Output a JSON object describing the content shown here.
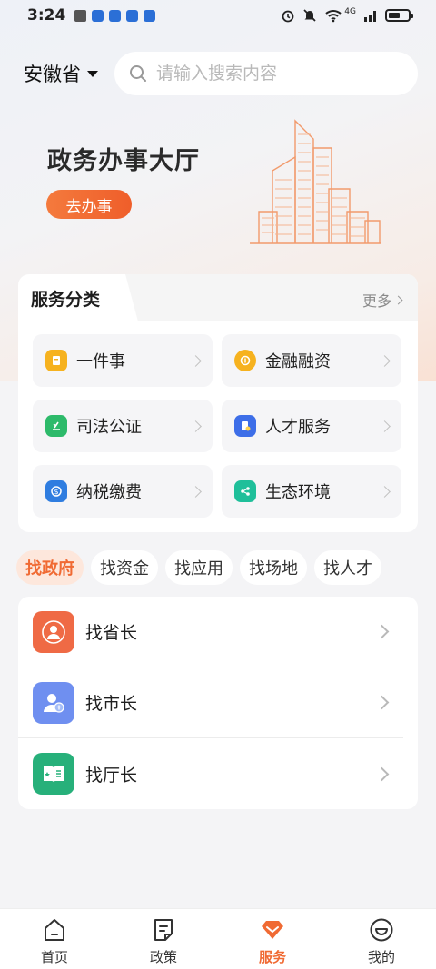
{
  "status_bar": {
    "time": "3:24",
    "network": "4G"
  },
  "header": {
    "province": "安徽省",
    "search_placeholder": "请输入搜索内容"
  },
  "hero": {
    "title": "政务办事大厅",
    "button": "去办事"
  },
  "service_category": {
    "title": "服务分类",
    "more": "更多",
    "items": [
      {
        "label": "一件事",
        "icon": "document-icon",
        "color": "#f6b21f"
      },
      {
        "label": "金融融资",
        "icon": "finance-icon",
        "color": "#f6b21f"
      },
      {
        "label": "司法公证",
        "icon": "justice-icon",
        "color": "#2dba6a"
      },
      {
        "label": "人才服务",
        "icon": "talent-icon",
        "color": "#3d6ee8"
      },
      {
        "label": "纳税缴费",
        "icon": "tax-icon",
        "color": "#2f7de0"
      },
      {
        "label": "生态环境",
        "icon": "ecology-icon",
        "color": "#1fbf9a"
      }
    ]
  },
  "filter_tabs": [
    {
      "label": "找政府",
      "active": true
    },
    {
      "label": "找资金",
      "active": false
    },
    {
      "label": "找应用",
      "active": false
    },
    {
      "label": "找场地",
      "active": false
    },
    {
      "label": "找人才",
      "active": false
    }
  ],
  "list": [
    {
      "label": "找省长",
      "icon": "governor-icon",
      "color": "#ef6a45"
    },
    {
      "label": "找市长",
      "icon": "mayor-icon",
      "color": "#6f8ff0"
    },
    {
      "label": "找厅长",
      "icon": "director-icon",
      "color": "#27b07a"
    }
  ],
  "bottom_nav": [
    {
      "label": "首页",
      "icon": "home-icon",
      "active": false
    },
    {
      "label": "政策",
      "icon": "policy-icon",
      "active": false
    },
    {
      "label": "服务",
      "icon": "service-icon",
      "active": true
    },
    {
      "label": "我的",
      "icon": "profile-icon",
      "active": false
    }
  ],
  "colors": {
    "accent": "#f06a33",
    "background": "#f4f4f6"
  }
}
